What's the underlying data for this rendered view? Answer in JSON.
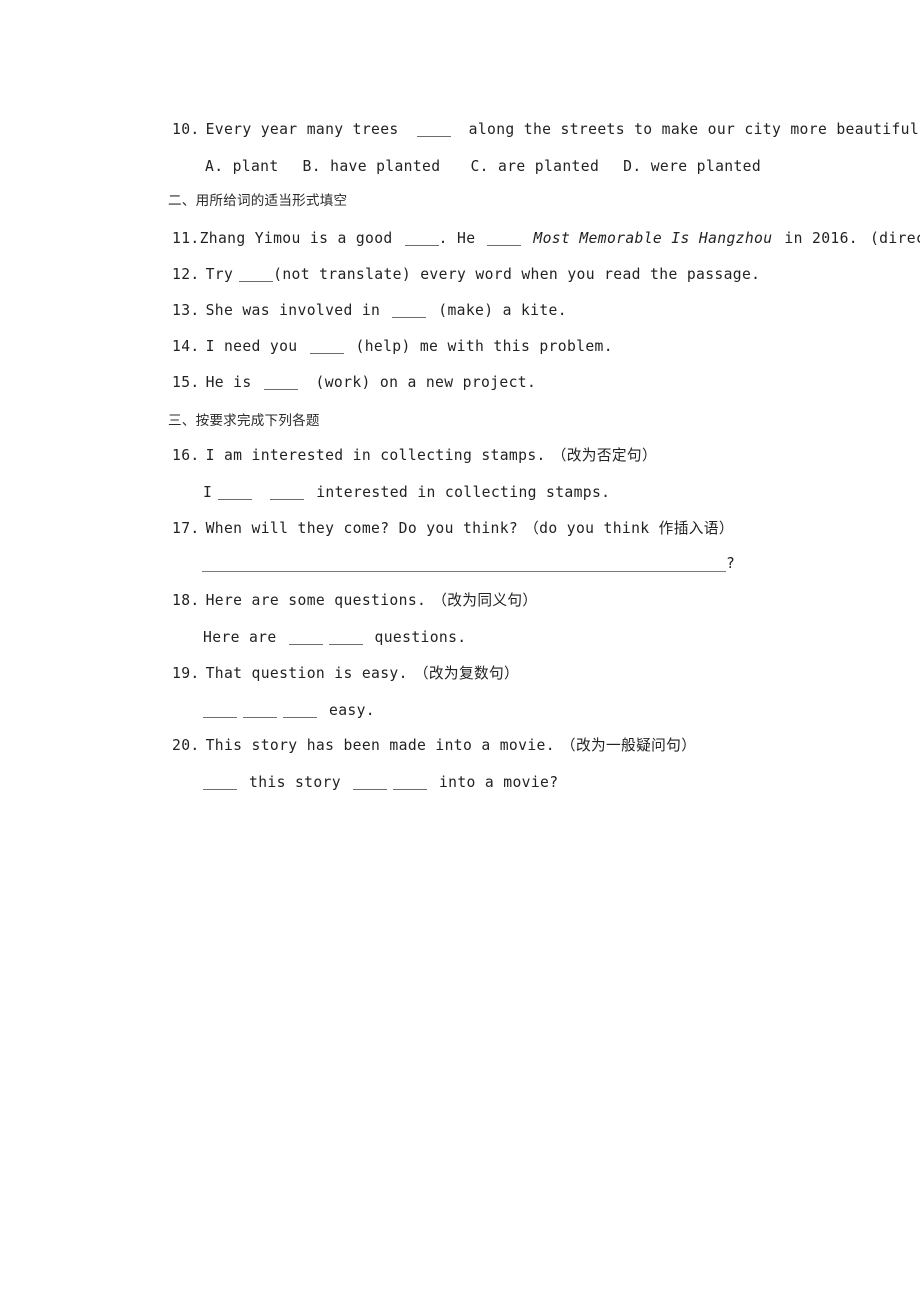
{
  "document": {
    "type": "english-grammar-worksheet",
    "language": "zh-CN + en"
  },
  "questions": {
    "q10": {
      "number": "10.",
      "stem_before": "Every year many trees",
      "stem_after": "along the streets to make our city more beautiful.",
      "options": [
        "A. plant",
        "B. have planted",
        "C. are planted",
        "D. were planted"
      ]
    },
    "q11": {
      "number": "11.",
      "part1": "Zhang Yimou is a good",
      "part2": ". He",
      "title_italic": "Most Memorable Is Hangzhou",
      "part3": "in 2016.",
      "cue": "(direct)"
    },
    "q12": {
      "number": "12.",
      "part1": "Try",
      "part2": "(not translate) every word when you read the passage."
    },
    "q13": {
      "number": "13.",
      "part1": "She was involved in",
      "part2": "(make) a kite."
    },
    "q14": {
      "number": "14.",
      "part1": "I need you",
      "part2": "(help) me with this problem."
    },
    "q15": {
      "number": "15.",
      "part1": "He is",
      "part2": "(work) on a new project."
    },
    "q16": {
      "number": "16.",
      "stem": "I am interested in collecting stamps.",
      "instruction": "（改为否定句）",
      "answer_before": "I",
      "answer_after": "interested in collecting stamps."
    },
    "q17": {
      "number": "17.",
      "stem": "When will they come? Do you think?",
      "instruction": "（do you think 作插入语）",
      "answer_end": "?"
    },
    "q18": {
      "number": "18.",
      "stem": "Here are some questions.",
      "instruction": "（改为同义句）",
      "answer_before": "Here are",
      "answer_after": "questions."
    },
    "q19": {
      "number": "19.",
      "stem": "That question is easy.",
      "instruction": "（改为复数句）",
      "answer_after": "easy."
    },
    "q20": {
      "number": "20.",
      "stem": "This story has been made into a movie.",
      "instruction": "（改为一般疑问句）",
      "answer_part1": "this story",
      "answer_part2": "into a movie?"
    }
  },
  "sections": {
    "two": "二、用所给词的适当形式填空",
    "three": "三、按要求完成下列各题"
  }
}
